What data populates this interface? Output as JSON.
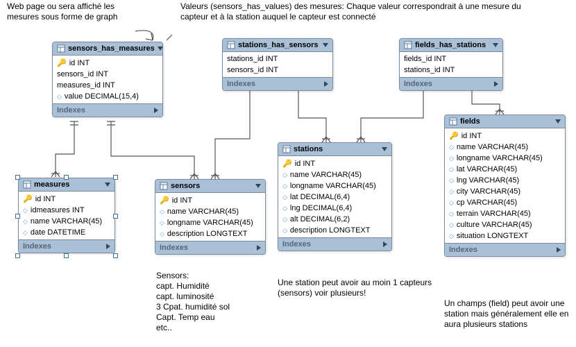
{
  "annotations": {
    "a1": "Web page ou sera affiché les mesures sous forme de graph",
    "a2": "Valeurs  (sensors_has_values) des mesures: Chaque valeur correspondrait à une mesure du capteur et à la station auquel  le capteur est connecté",
    "a3": "Sensors:\ncapt. Humidité\ncapt. luminosité\n3 Cpat. humidité sol\nCapt. Temp eau\netc..",
    "a4": "Une station peut avoir au moin 1 capteurs (sensors) voir plusieurs!",
    "a5": "Un champs (field) peut avoir une station mais généralement elle en aura plusieurs stations"
  },
  "ui": {
    "indexes_label": "Indexes"
  },
  "tables": {
    "sensors_has_measures": {
      "title": "sensors_has_measures",
      "cols": [
        "id INT",
        "sensors_id INT",
        "measures_id INT",
        "value DECIMAL(15,4)"
      ],
      "pk": [
        0
      ]
    },
    "stations_has_sensors": {
      "title": "stations_has_sensors",
      "cols": [
        "stations_id INT",
        "sensors_id INT"
      ],
      "pk": []
    },
    "fields_has_stations": {
      "title": "fields_has_stations",
      "cols": [
        "fields_id INT",
        "stations_id INT"
      ],
      "pk": []
    },
    "measures": {
      "title": "measures",
      "cols": [
        "id INT",
        "idmeasures INT",
        "name VARCHAR(45)",
        "date DATETIME"
      ],
      "pk": [
        0
      ]
    },
    "sensors": {
      "title": "sensors",
      "cols": [
        "id INT",
        "name VARCHAR(45)",
        "longname VARCHAR(45)",
        "description LONGTEXT"
      ],
      "pk": [
        0
      ]
    },
    "stations": {
      "title": "stations",
      "cols": [
        "id INT",
        "name VARCHAR(45)",
        "longname VARCHAR(45)",
        "lat DECIMAL(6,4)",
        "lng DECIMAL(6,4)",
        "alt DECIMAL(6,2)",
        "description LONGTEXT"
      ],
      "pk": [
        0
      ]
    },
    "fields": {
      "title": "fields",
      "cols": [
        "id INT",
        "name VARCHAR(45)",
        "longname VARCHAR(45)",
        "lat VARCHAR(45)",
        "lng VARCHAR(45)",
        "city VARCHAR(45)",
        "cp VARCHAR(45)",
        "terrain VARCHAR(45)",
        "culture VARCHAR(45)",
        "situation LONGTEXT"
      ],
      "pk": [
        0
      ]
    }
  },
  "chart_data": {
    "type": "table",
    "title": "Entity-Relationship Diagram",
    "entities": [
      {
        "name": "sensors_has_measures",
        "columns": [
          {
            "name": "id",
            "type": "INT",
            "pk": true
          },
          {
            "name": "sensors_id",
            "type": "INT"
          },
          {
            "name": "measures_id",
            "type": "INT"
          },
          {
            "name": "value",
            "type": "DECIMAL(15,4)"
          }
        ]
      },
      {
        "name": "stations_has_sensors",
        "columns": [
          {
            "name": "stations_id",
            "type": "INT"
          },
          {
            "name": "sensors_id",
            "type": "INT"
          }
        ]
      },
      {
        "name": "fields_has_stations",
        "columns": [
          {
            "name": "fields_id",
            "type": "INT"
          },
          {
            "name": "stations_id",
            "type": "INT"
          }
        ]
      },
      {
        "name": "measures",
        "columns": [
          {
            "name": "id",
            "type": "INT",
            "pk": true
          },
          {
            "name": "idmeasures",
            "type": "INT"
          },
          {
            "name": "name",
            "type": "VARCHAR(45)"
          },
          {
            "name": "date",
            "type": "DATETIME"
          }
        ]
      },
      {
        "name": "sensors",
        "columns": [
          {
            "name": "id",
            "type": "INT",
            "pk": true
          },
          {
            "name": "name",
            "type": "VARCHAR(45)"
          },
          {
            "name": "longname",
            "type": "VARCHAR(45)"
          },
          {
            "name": "description",
            "type": "LONGTEXT"
          }
        ]
      },
      {
        "name": "stations",
        "columns": [
          {
            "name": "id",
            "type": "INT",
            "pk": true
          },
          {
            "name": "name",
            "type": "VARCHAR(45)"
          },
          {
            "name": "longname",
            "type": "VARCHAR(45)"
          },
          {
            "name": "lat",
            "type": "DECIMAL(6,4)"
          },
          {
            "name": "lng",
            "type": "DECIMAL(6,4)"
          },
          {
            "name": "alt",
            "type": "DECIMAL(6,2)"
          },
          {
            "name": "description",
            "type": "LONGTEXT"
          }
        ]
      },
      {
        "name": "fields",
        "columns": [
          {
            "name": "id",
            "type": "INT",
            "pk": true
          },
          {
            "name": "name",
            "type": "VARCHAR(45)"
          },
          {
            "name": "longname",
            "type": "VARCHAR(45)"
          },
          {
            "name": "lat",
            "type": "VARCHAR(45)"
          },
          {
            "name": "lng",
            "type": "VARCHAR(45)"
          },
          {
            "name": "city",
            "type": "VARCHAR(45)"
          },
          {
            "name": "cp",
            "type": "VARCHAR(45)"
          },
          {
            "name": "terrain",
            "type": "VARCHAR(45)"
          },
          {
            "name": "culture",
            "type": "VARCHAR(45)"
          },
          {
            "name": "situation",
            "type": "LONGTEXT"
          }
        ]
      }
    ],
    "relationships": [
      {
        "from": "sensors_has_measures",
        "to": "measures"
      },
      {
        "from": "sensors_has_measures",
        "to": "sensors"
      },
      {
        "from": "stations_has_sensors",
        "to": "sensors"
      },
      {
        "from": "stations_has_sensors",
        "to": "stations"
      },
      {
        "from": "fields_has_stations",
        "to": "stations"
      },
      {
        "from": "fields_has_stations",
        "to": "fields"
      }
    ]
  }
}
